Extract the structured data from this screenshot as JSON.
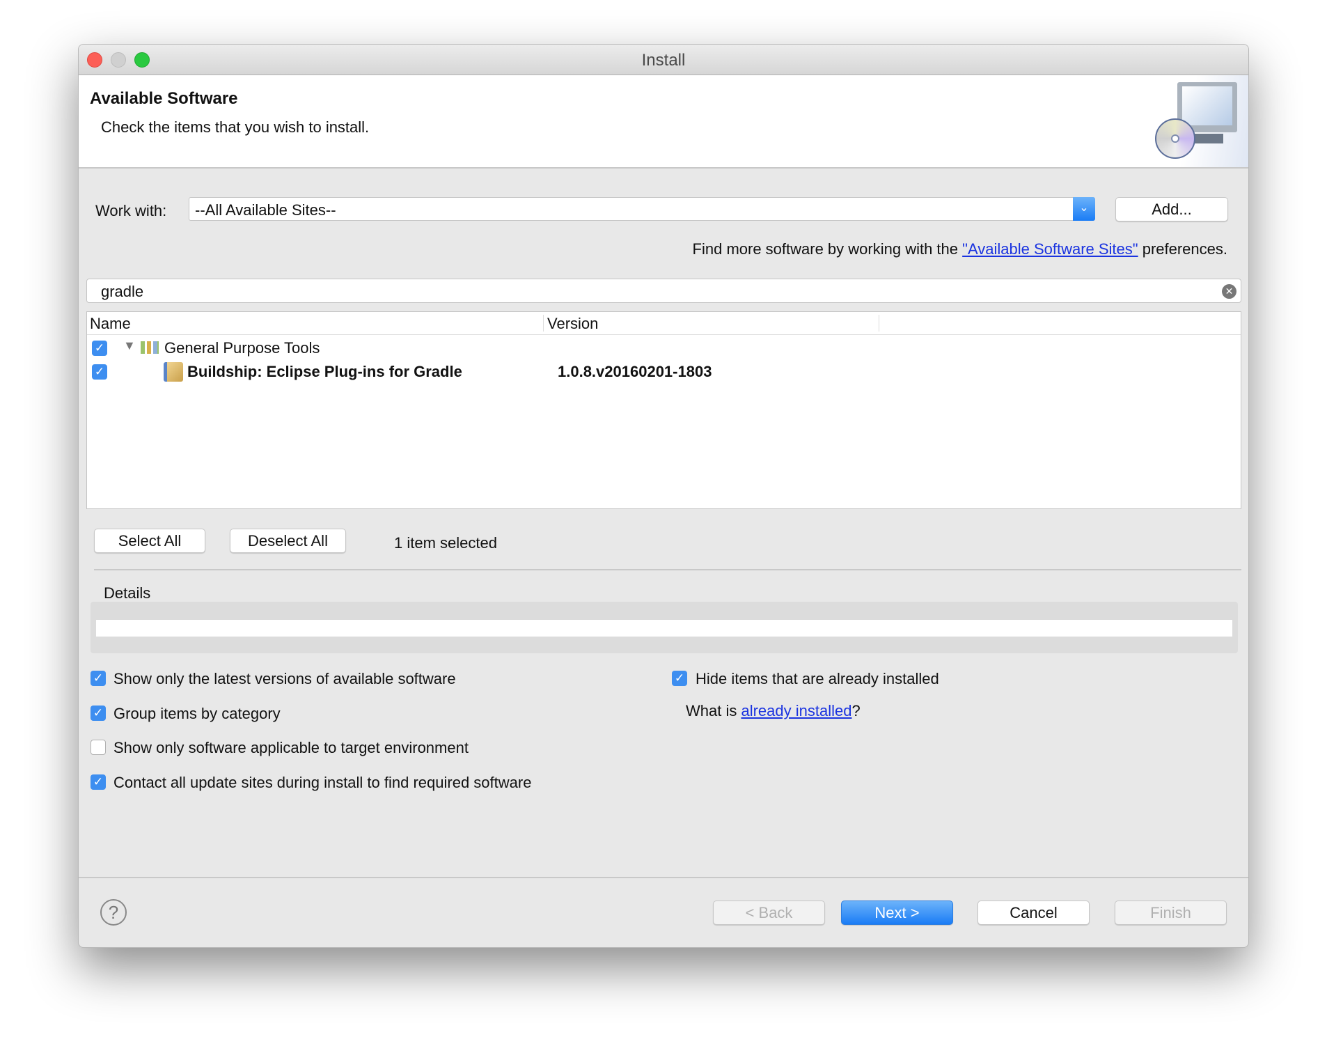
{
  "window": {
    "title": "Install"
  },
  "header": {
    "title": "Available Software",
    "subtitle": "Check the items that you wish to install.",
    "icon": "install-monitor-cd-icon"
  },
  "work_with": {
    "label": "Work with:",
    "value": "--All Available Sites--",
    "add_label": "Add..."
  },
  "find_more": {
    "prefix": "Find more software by working with the ",
    "link": "\"Available Software Sites\"",
    "suffix": " preferences."
  },
  "filter": {
    "value": "gradle"
  },
  "table": {
    "columns": [
      "Name",
      "Version"
    ],
    "rows": [
      {
        "name": "General Purpose Tools",
        "version": "",
        "checked": true,
        "expanded": true,
        "bold": false
      },
      {
        "name": "Buildship: Eclipse Plug-ins for Gradle",
        "version": "1.0.8.v20160201-1803",
        "checked": true,
        "bold": true
      }
    ]
  },
  "selection": {
    "select_all": "Select All",
    "deselect_all": "Deselect All",
    "status": "1 item selected"
  },
  "details": {
    "label": "Details"
  },
  "options": [
    {
      "label": "Show only the latest versions of available software",
      "checked": true
    },
    {
      "label": "Group items by category",
      "checked": true
    },
    {
      "label": "Show only software applicable to target environment",
      "checked": false
    },
    {
      "label": "Contact all update sites during install to find required software",
      "checked": true
    },
    {
      "label": "Hide items that are already installed",
      "checked": true
    }
  ],
  "installed_hint": {
    "prefix": "What is ",
    "link": "already installed",
    "suffix": "?"
  },
  "footer": {
    "back": "< Back",
    "next": "Next >",
    "cancel": "Cancel",
    "finish": "Finish"
  },
  "colors": {
    "accent": "#1a7cf5",
    "link": "#1a33e0",
    "close": "#fc5f57",
    "minimize": "#d0d0d0",
    "zoom": "#2ac940"
  }
}
